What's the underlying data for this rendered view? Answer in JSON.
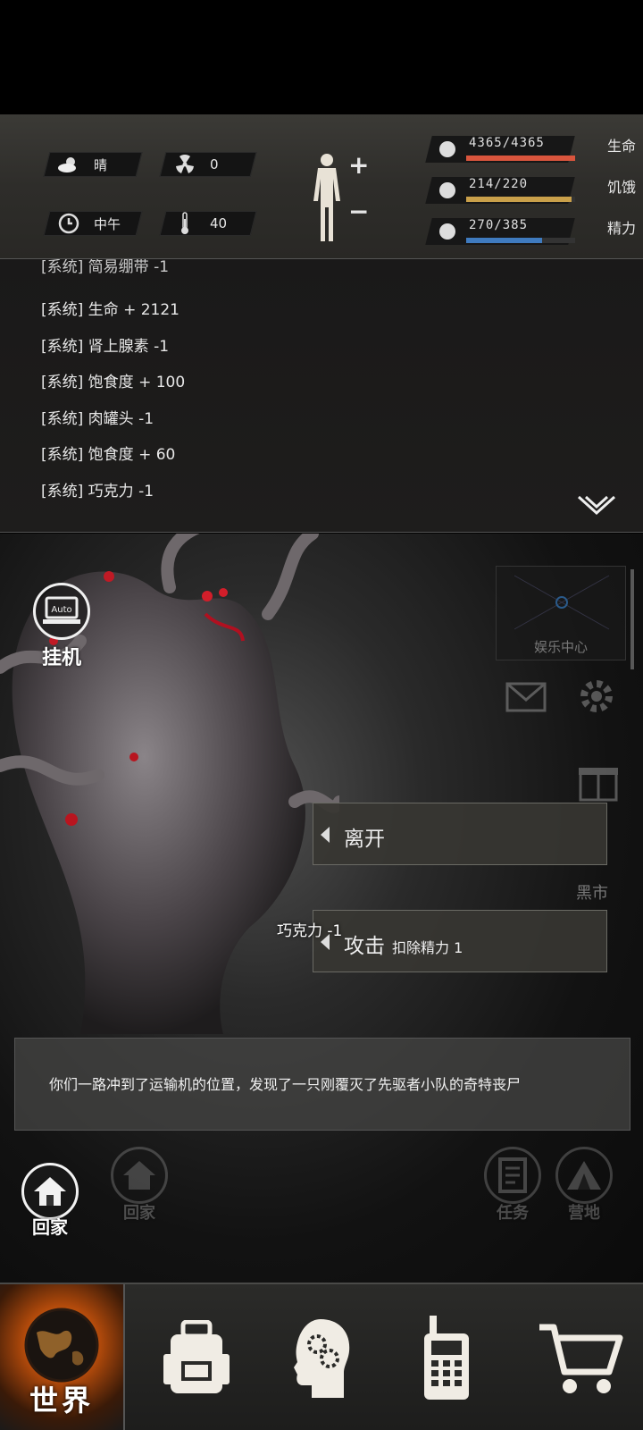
{
  "status": {
    "weather": "晴",
    "radiation": "0",
    "time_of_day": "中午",
    "temperature": "40",
    "stats": [
      {
        "name": "生命",
        "value": "4365/4365",
        "fill": 1.0,
        "color": "#d9553d",
        "icon": "heart-pulse-icon"
      },
      {
        "name": "饥饿",
        "value": "214/220",
        "fill": 0.97,
        "color": "#c9a04a",
        "icon": "stomach-icon"
      },
      {
        "name": "精力",
        "value": "270/385",
        "fill": 0.7,
        "color": "#3f7bbf",
        "icon": "brain-energy-icon"
      }
    ]
  },
  "log": {
    "partial": "[系统] 简易绷带 -1",
    "lines": [
      "[系统] 生命 + 2121",
      "[系统] 肾上腺素 -1",
      "[系统] 饱食度 + 100",
      "[系统] 肉罐头 -1",
      "[系统] 饱食度 + 60",
      "[系统] 巧克力 -1"
    ]
  },
  "scene": {
    "auto_icon_text": "Auto",
    "auto_label": "挂机",
    "entertainment": "娱乐中心",
    "black_market": "黑市",
    "choices": [
      {
        "label": "离开",
        "sub": ""
      },
      {
        "label": "攻击",
        "sub": "扣除精力 1"
      }
    ],
    "floating_text": "巧克力 -1",
    "description": "你们一路冲到了运输机的位置，发现了一只刚覆灭了先驱者小队的奇特丧尸",
    "home_active": "回家",
    "home_dim": "回家",
    "quest": "任务",
    "camp": "营地"
  },
  "nav": {
    "world": "世界",
    "items": [
      "backpack-icon",
      "skills-head-icon",
      "radio-icon",
      "shop-cart-icon"
    ]
  },
  "colors": {
    "accent_orange": "#f08a20"
  }
}
